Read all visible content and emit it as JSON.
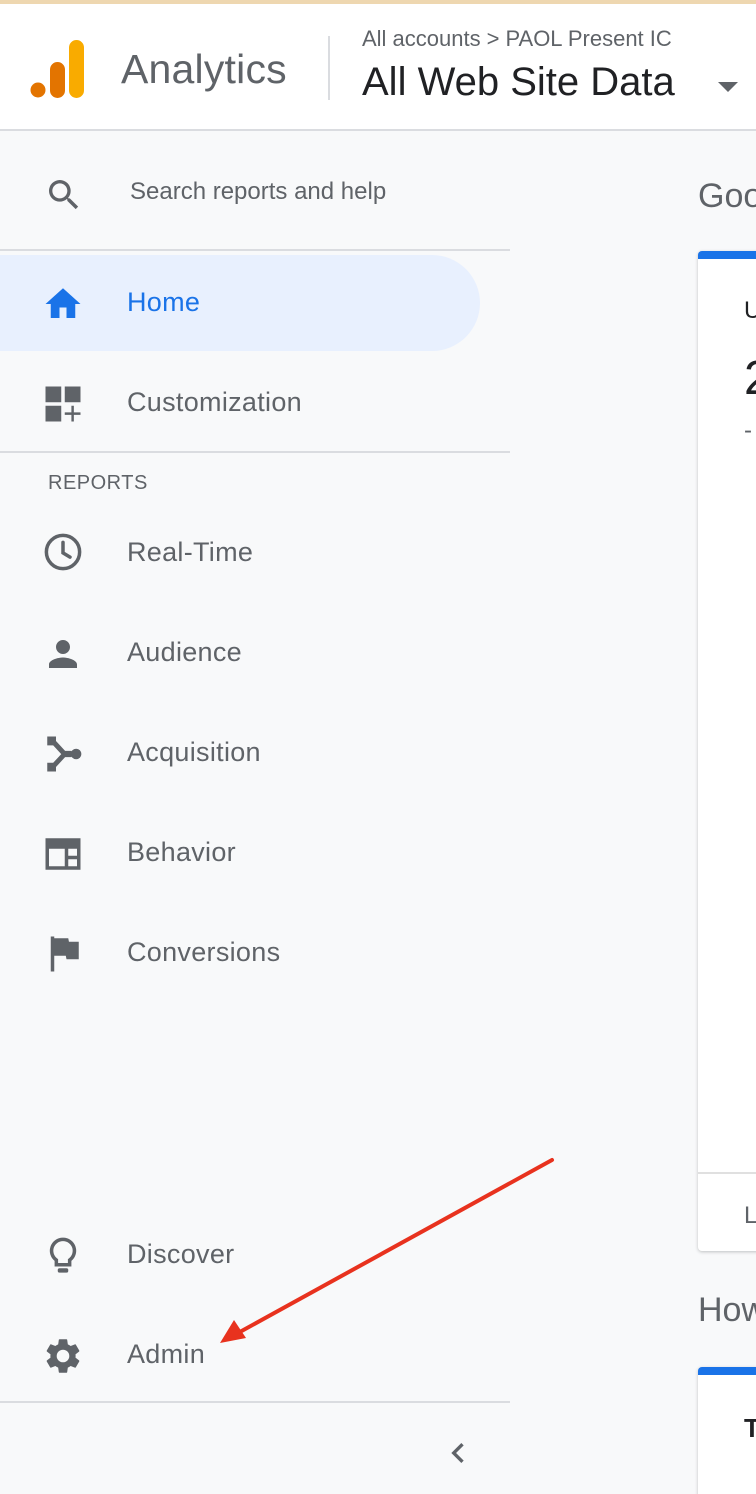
{
  "header": {
    "product_name": "Analytics",
    "breadcrumb": {
      "root": "All accounts",
      "separator": ">",
      "account": "PAOL Present IC"
    },
    "view_name": "All Web Site Data"
  },
  "search": {
    "placeholder": "Search reports and help"
  },
  "nav": {
    "home": "Home",
    "customization": "Customization",
    "reports_header": "REPORTS",
    "realtime": "Real-Time",
    "audience": "Audience",
    "acquisition": "Acquisition",
    "behavior": "Behavior",
    "conversions": "Conversions",
    "discover": "Discover",
    "admin": "Admin"
  },
  "main": {
    "title_partial": "Goo",
    "card_label_partial": "U",
    "card_value_partial": "2",
    "card_delta_partial": "-",
    "card_footer_partial": "L",
    "title2_partial": "How",
    "card2_label_partial": "T"
  },
  "colors": {
    "accent": "#1a73e8",
    "active_bg": "#e8f0fe",
    "logo_orange": "#f9ab00",
    "logo_dark_orange": "#e37400",
    "annotation_red": "#e8321e"
  },
  "icons": {
    "search": "search-icon",
    "home": "home-icon",
    "customization": "dashboard-add-icon",
    "realtime": "clock-icon",
    "audience": "person-icon",
    "acquisition": "merge-icon",
    "behavior": "web-layout-icon",
    "conversions": "flag-icon",
    "discover": "lightbulb-icon",
    "admin": "gear-icon",
    "collapse": "chevron-left-icon"
  }
}
